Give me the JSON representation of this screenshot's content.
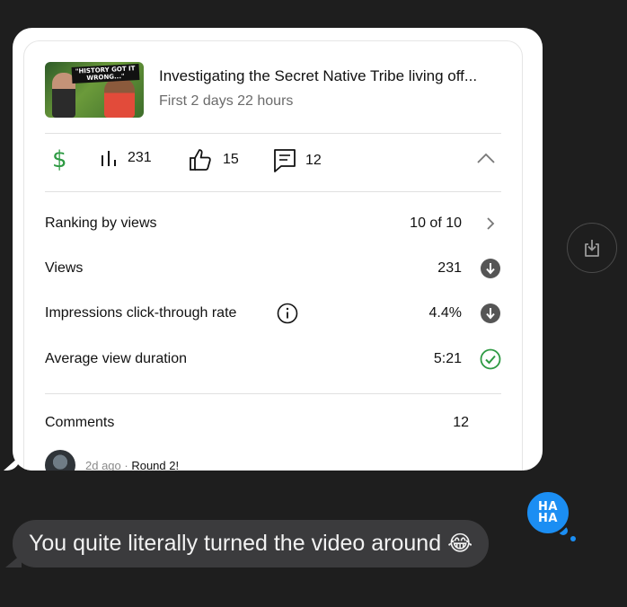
{
  "video": {
    "thumbnail_text": "\"HISTORY GOT IT\nWRONG...\"",
    "title": "Investigating the Secret Native Tribe living off...",
    "subtitle": "First 2 days 22 hours"
  },
  "stats": {
    "views": "231",
    "likes": "15",
    "comments": "12"
  },
  "metrics": [
    {
      "label": "Ranking by views",
      "value": "10 of 10"
    },
    {
      "label": "Views",
      "value": "231"
    },
    {
      "label": "Impressions click-through rate",
      "value": "4.4%"
    },
    {
      "label": "Average view duration",
      "value": "5:21"
    }
  ],
  "comments_section": {
    "label": "Comments",
    "count": "12",
    "first_comment_time": "2d ago",
    "separator": " · ",
    "first_comment_text": "Round 2!"
  },
  "message": {
    "text": "You quite literally turned the video around",
    "emoji": "😂"
  },
  "tapback": {
    "label": "HA\nHA"
  },
  "colors": {
    "green": "#2e9a43",
    "imessage_blue": "#1b8ef3",
    "bubble_gray": "#3b3b3d"
  },
  "icons": [
    "dollar-icon",
    "bar-chart-icon",
    "thumbs-up-icon",
    "comment-icon",
    "chevron-up-icon",
    "chevron-right-icon",
    "arrow-down-circle-icon",
    "info-icon",
    "check-circle-icon",
    "share-icon"
  ]
}
